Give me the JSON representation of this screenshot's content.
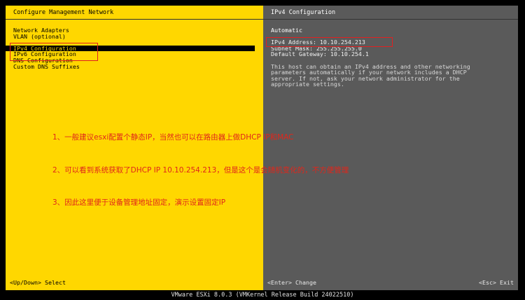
{
  "left_pane": {
    "title": "Configure Management Network",
    "menu_items": [
      {
        "label": "Network Adapters"
      },
      {
        "label": "VLAN (optional)"
      },
      {
        "label": "IPv4 Configuration"
      },
      {
        "label": "IPv6 Configuration"
      },
      {
        "label": "DNS Configuration"
      },
      {
        "label": "Custom DNS Suffixes"
      }
    ],
    "footer_key": "<Up/Down>",
    "footer_action": "Select"
  },
  "right_pane": {
    "title": "IPv4 Configuration",
    "heading": "Automatic",
    "ipv4_address": "IPv4 Address: 10.10.254.213",
    "subnet_mask": "Subnet Mask: 255.255.255.0",
    "default_gateway": "Default Gateway: 10.10.254.1",
    "description": "This host can obtain an IPv4 address and other networking\nparameters automatically if your network includes a DHCP\nserver. If not, ask your network administrator for the\nappropriate settings.",
    "footer_enter_key": "<Enter>",
    "footer_enter_action": "Change",
    "footer_esc_key": "<Esc>",
    "footer_esc_action": "Exit"
  },
  "status_bar": "VMware ESXi 8.0.3 (VMKernel Release Build 24022510)",
  "annotations": [
    "1、一般建议esxi配置个静态IP，当然也可以在路由器上做DHCP IP和MAC",
    "2、可以看到系统获取了DHCP IP 10.10.254.213，但是这个是会随机变化的，不方便管理",
    "3、因此这里便于设备管理地址固定，演示设置固定IP"
  ],
  "colors": {
    "left_bg": "#FFD700",
    "right_bg": "#5a5a5a",
    "annotation": "#e0261b",
    "highlight_box": "#e02020"
  }
}
